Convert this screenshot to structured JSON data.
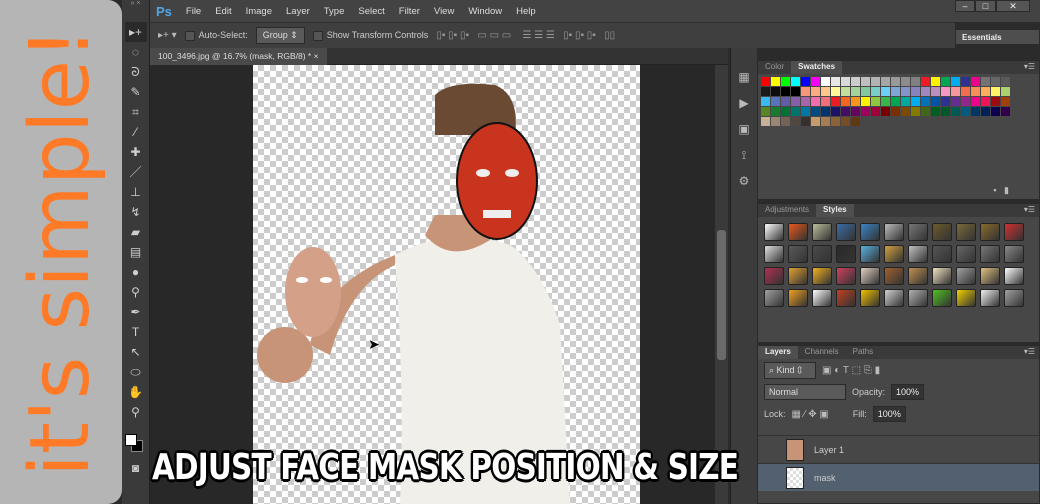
{
  "banner": {
    "text": "it's simple!"
  },
  "menubar": {
    "logo": "Ps",
    "items": [
      "File",
      "Edit",
      "Image",
      "Layer",
      "Type",
      "Select",
      "Filter",
      "View",
      "Window",
      "Help"
    ]
  },
  "window_controls": {
    "minimize": "‒",
    "maximize": "□",
    "close": "✕"
  },
  "options": {
    "auto_select_label": "Auto-Select:",
    "auto_select_value": "Group",
    "show_transform_label": "Show Transform Controls",
    "workspace": "Essentials"
  },
  "document": {
    "tab_title": "100_3496.jpg @ 16.7% (mask, RGB/8) *",
    "close": "×"
  },
  "swatches_panel": {
    "tabs": [
      "Color",
      "Swatches"
    ],
    "active": "Swatches",
    "colors": [
      "#ff0000",
      "#ffff00",
      "#00ff00",
      "#00ffff",
      "#0000ff",
      "#ff00ff",
      "#ffffff",
      "#e6e6e6",
      "#d9d9d9",
      "#cccccc",
      "#bfbfbf",
      "#b3b3b3",
      "#a6a6a6",
      "#999999",
      "#8c8c8c",
      "#808080",
      "#ed1c24",
      "#fff200",
      "#00a651",
      "#00aeef",
      "#2e3192",
      "#ec008c",
      "#737373",
      "#666666",
      "#595959",
      "#1a1a1a",
      "#0d0d0d",
      "#000000",
      "#000000",
      "#f7977a",
      "#f9ad81",
      "#fdc68a",
      "#fff79a",
      "#c4df9b",
      "#a3d39c",
      "#82ca9d",
      "#7bcdc8",
      "#6ecff6",
      "#7ea7d8",
      "#8493ca",
      "#8882be",
      "#a187be",
      "#bc8dbf",
      "#f49ac2",
      "#f6989d",
      "#f26c4f",
      "#f68e55",
      "#fbaf5c",
      "#fff467",
      "#acd372",
      "#3cb8f0",
      "#5674b9",
      "#605ca8",
      "#855fa8",
      "#a864a8",
      "#f06eaa",
      "#f26d7d",
      "#ed1c24",
      "#f26522",
      "#f7941d",
      "#fff200",
      "#8dc63f",
      "#39b54a",
      "#00a651",
      "#00a99d",
      "#00aeef",
      "#0072bc",
      "#0054a6",
      "#2e3192",
      "#662d91",
      "#92278f",
      "#ec008c",
      "#ed145b",
      "#9e0b0f",
      "#a0410d",
      "#598527",
      "#197b30",
      "#007236",
      "#00746b",
      "#0076a3",
      "#004b80",
      "#003471",
      "#1b1464",
      "#440e62",
      "#630460",
      "#9e005d",
      "#9e0039",
      "#790000",
      "#7b2e00",
      "#7d4900",
      "#827b00",
      "#406618",
      "#005e20",
      "#005826",
      "#005952",
      "#005b7f",
      "#003663",
      "#002157",
      "#0d004c",
      "#32004b",
      "#c7b299",
      "#998675",
      "#736357",
      "#534741",
      "#37302d",
      "#c69c6d",
      "#a67c52",
      "#8c6239",
      "#754c24",
      "#603913"
    ]
  },
  "styles_panel": {
    "tabs": [
      "Adjustments",
      "Styles"
    ],
    "active": "Styles",
    "colors": [
      "#ffffff",
      "#e8581a",
      "#bdbd9a",
      "#3a6ea5",
      "#3a85c8",
      "#bbbbbb",
      "#777777",
      "#6d5a2a",
      "#7a6a3a",
      "#8a6a2a",
      "#d03030",
      "#e0e0e0",
      "#5a5a5a",
      "#4a4a4a",
      "#2a2a2a",
      "#5ab0e0",
      "#d0a040",
      "#c0c0c0",
      "#555555",
      "#666666",
      "#777777",
      "#888888",
      "#b03050",
      "#e0a030",
      "#f0b020",
      "#d04060",
      "#e0d0c0",
      "#a06030",
      "#c09050",
      "#f0e0c0",
      "#a0a0a0",
      "#e0c080",
      "#ffffff",
      "#a0a0a0",
      "#f0a020",
      "#ffffff",
      "#c04020",
      "#f0c000",
      "#d0d0d0",
      "#b0b0b0",
      "#50c020",
      "#f0d000",
      "#f0f0f0",
      "#a0a0a0"
    ]
  },
  "layers_panel": {
    "tabs": [
      "Layers",
      "Channels",
      "Paths"
    ],
    "active": "Layers",
    "filter": "Kind",
    "blend_mode": "Normal",
    "opacity_label": "Opacity:",
    "opacity": "100%",
    "lock_label": "Lock:",
    "fill_label": "Fill:",
    "fill": "100%",
    "layers": [
      {
        "name": "Layer 1",
        "selected": false
      },
      {
        "name": "mask",
        "selected": true
      }
    ]
  },
  "caption": "ADJUST FACE MASK POSITION & SIZE"
}
